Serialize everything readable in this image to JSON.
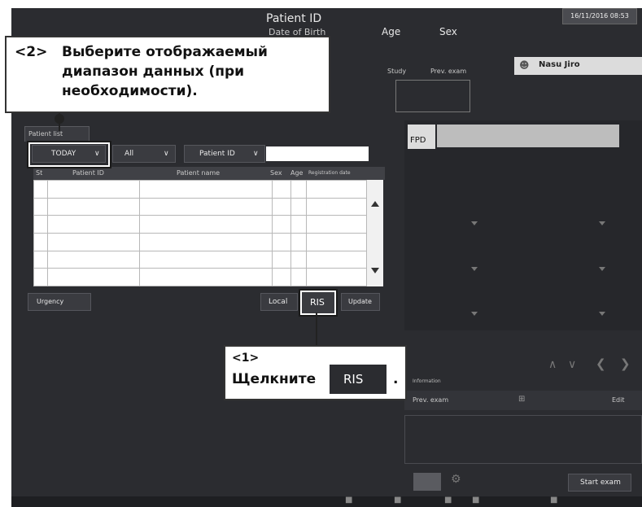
{
  "header": {
    "patient_id_label": "Patient ID",
    "dob_label": "Date of Birth",
    "age_label": "Age",
    "sex_label": "Sex",
    "datetime": "16/11/2016 08:53",
    "tab_study": "Study",
    "tab_prev": "Prev. exam",
    "user_name": "Nasu Jiro"
  },
  "patient_list": {
    "tab_label": "Patient list",
    "range_value": "TODAY",
    "filter_value": "All",
    "search_field_value": "Patient ID",
    "search_input": "",
    "columns": [
      "St",
      "Patient ID",
      "Patient name",
      "Sex",
      "Age",
      "Registration date"
    ],
    "urgency_label": "Urgency",
    "local_label": "Local",
    "ris_label": "RIS",
    "update_label": "Update"
  },
  "right_panel": {
    "fpd_label": "FPD",
    "information_label": "Information",
    "prev_label": "Prev. exam",
    "edit_label": "Edit",
    "start_exam_label": "Start exam"
  },
  "callouts": {
    "step2_number": "<2>",
    "step2_text": "Выберите отображаемый диапазон данных (при необходимости).",
    "step1_number": "<1>",
    "step1_prefix": "Щелкните",
    "step1_button": "RIS",
    "step1_suffix": "."
  },
  "colors": {
    "screen_bg": "#2b2c30",
    "callout_bg": "#ffffff",
    "highlight": "#ffffff"
  }
}
